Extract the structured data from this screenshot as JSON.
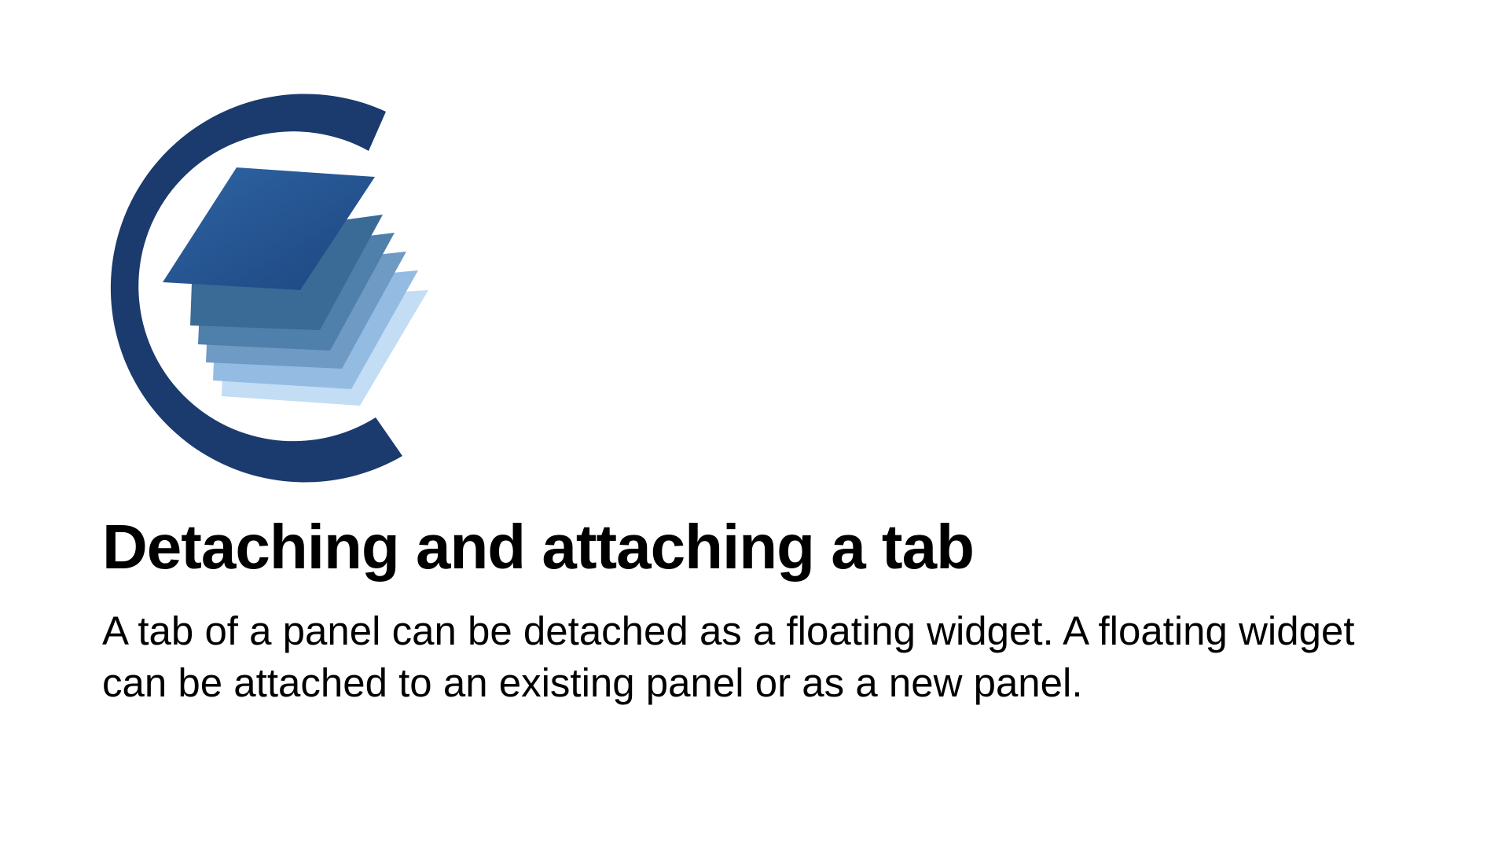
{
  "slide": {
    "title": "Detaching and attaching a tab",
    "description": "A tab of a panel can be detached as a floating widget. A floating widget can be attached to an existing panel or as a new panel."
  },
  "logo": {
    "icon": "stacked-layers-c-logo",
    "colors": {
      "ring": "#1b3a6e",
      "layer_top": "#2a5a96",
      "layer_2": "#3a6b96",
      "layer_3": "#4f7fab",
      "layer_4": "#6e9ac4",
      "layer_5": "#94bce2",
      "layer_6": "#c3ddf5"
    }
  }
}
